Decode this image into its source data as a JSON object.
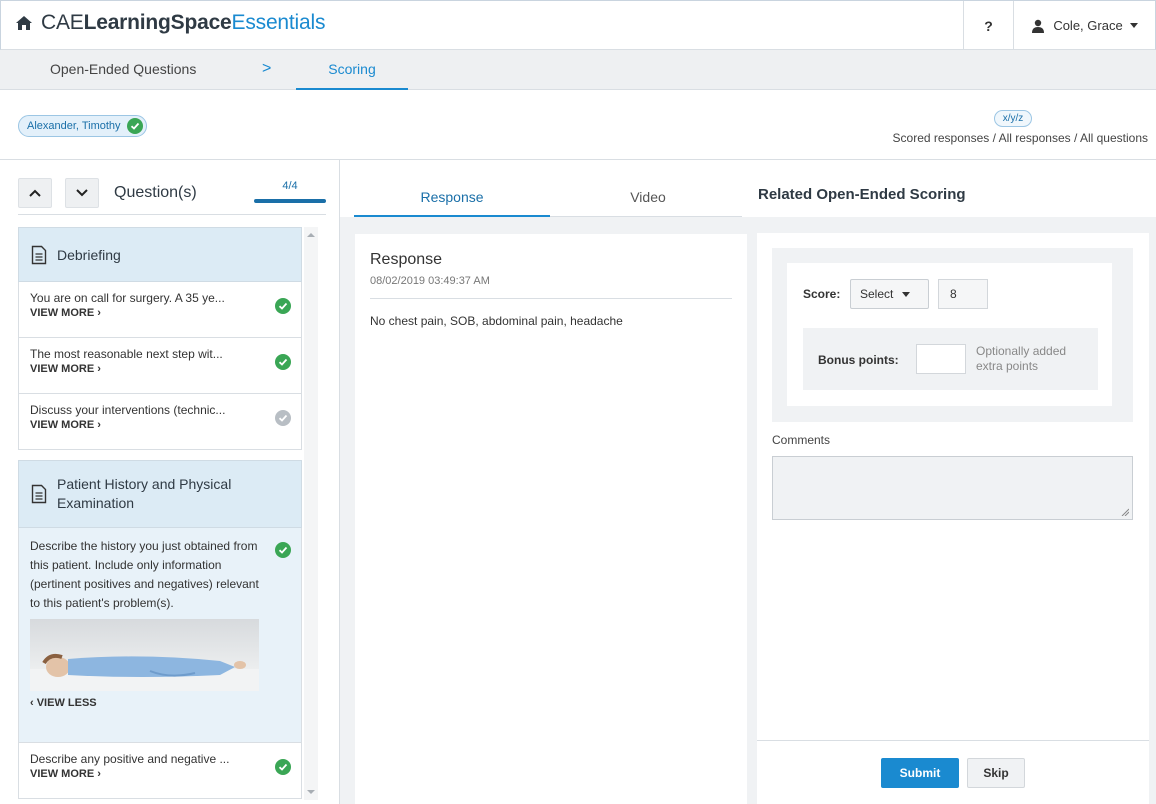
{
  "app": {
    "brand_prefix": "CAE",
    "brand_bold": "LearningSpace",
    "brand_suffix": "Essentials",
    "help_label": "?",
    "user_name": "Cole, Grace"
  },
  "breadcrumb": {
    "items": [
      "Open-Ended Questions",
      "Scoring"
    ],
    "separator": ">"
  },
  "student": {
    "name": "Alexander, Timothy",
    "status": "scored"
  },
  "legend": {
    "badge": "x/y/z",
    "caption": "Scored responses / All responses / All questions"
  },
  "question_nav": {
    "label": "Question(s)",
    "count": "4/4",
    "progress": 1.0
  },
  "sections": [
    {
      "title": "Debriefing",
      "items": [
        {
          "text": "You are on call for surgery. A 35 ye...",
          "more": "VIEW MORE ›",
          "status": "scored"
        },
        {
          "text": "The most reasonable next step wit...",
          "more": "VIEW MORE ›",
          "status": "scored"
        },
        {
          "text": "Discuss your interventions (technic...",
          "more": "VIEW MORE ›",
          "status": "pending"
        }
      ]
    },
    {
      "title": "Patient History and Physical Examination",
      "items": [
        {
          "text": "Describe the history you just obtained from this patient. Include only information (pertinent positives and negatives) relevant to this patient's problem(s).",
          "more": "‹ VIEW LESS",
          "status": "scored"
        },
        {
          "text": "Describe any positive and negative ...",
          "more": "VIEW MORE ›",
          "status": "scored"
        }
      ]
    }
  ],
  "tabs": {
    "response": "Response",
    "video": "Video"
  },
  "response": {
    "title": "Response",
    "date": "08/02/2019 03:49:37 AM",
    "body": "No chest pain, SOB, abdominal pain, headache"
  },
  "scoring": {
    "title": "Related Open-Ended Scoring",
    "score_label": "Score:",
    "select_label": "Select",
    "score_value": "8",
    "bonus_label": "Bonus points:",
    "bonus_hint": "Optionally added extra points",
    "comments_label": "Comments",
    "submit_label": "Submit",
    "skip_label": "Skip"
  },
  "colors": {
    "accent": "#1a8ad0",
    "success": "#3aa655",
    "neutral": "#b8bec4"
  }
}
